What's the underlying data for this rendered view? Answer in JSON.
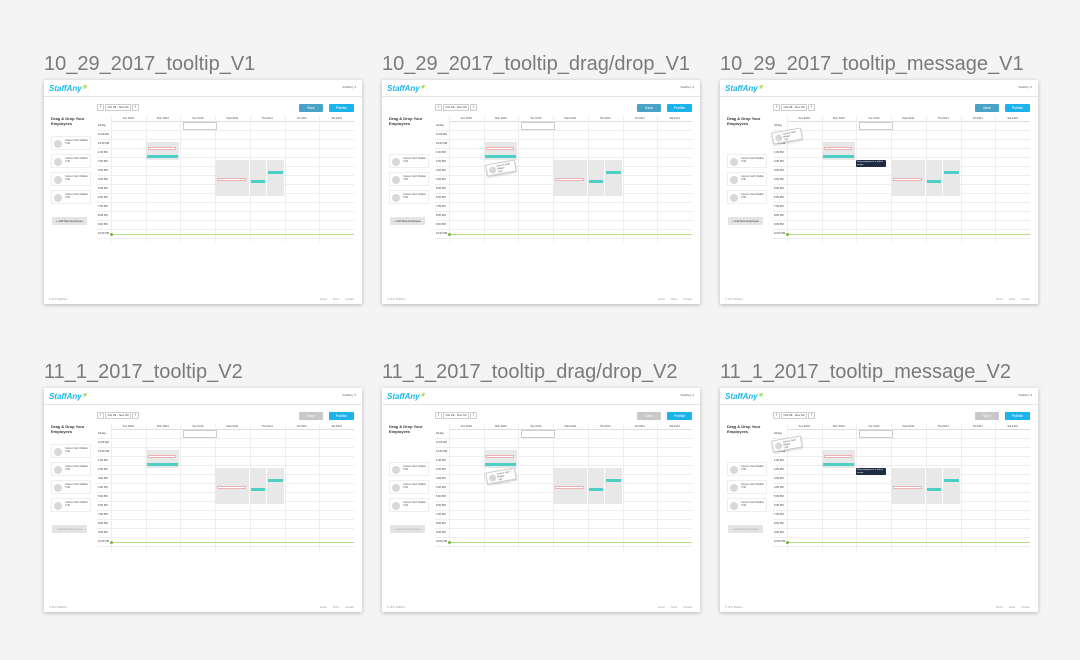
{
  "frames": [
    {
      "title": "10_29_2017_tooltip_V1",
      "variant": "v1",
      "state": "tooltip"
    },
    {
      "title": "10_29_2017_tooltip_drag/drop_V1",
      "variant": "v1",
      "state": "drag"
    },
    {
      "title": "10_29_2017_tooltip_message_V1",
      "variant": "v1",
      "state": "message"
    },
    {
      "title": "11_1_2017_tooltip_V2",
      "variant": "v2",
      "state": "tooltip"
    },
    {
      "title": "11_1_2017_tooltip_drag/drop_V2",
      "variant": "v2",
      "state": "drag"
    },
    {
      "title": "11_1_2017_tooltip_message_V2",
      "variant": "v2",
      "state": "message"
    }
  ],
  "app": {
    "logo": "StaffAny",
    "user_menu": "StaffAny ▾",
    "date_range": "Oct 29 - Nov 04",
    "save_label": "Save",
    "publish_label": "Publish",
    "sidebar_title": "Drag & Drop Your Employees",
    "add_employee_label": "+ Add New Employee",
    "employee_name": "Carson Seth Walker",
    "employee_hours": "7/40",
    "days": [
      "Sun 29/10",
      "Mon 30/10",
      "Tue 31/10",
      "Wed 01/11",
      "Thu 02/11",
      "Fri 03/11",
      "Sat 04/11"
    ],
    "times": [
      "All day",
      "11:00 AM",
      "12:00 PM",
      "1:00 PM",
      "2:00 PM",
      "3:00 PM",
      "4:00 PM",
      "5:00 PM",
      "6:00 PM",
      "7:00 PM",
      "8:00 PM",
      "9:00 PM",
      "10:00 PM"
    ],
    "footer_left": "© 2017 StaffAny",
    "footer_links": [
      "About",
      "Terms",
      "Contact"
    ],
    "tooltip_message": "Drag employee to a shift to assign"
  },
  "colors": {
    "accent": "#1ab4ea",
    "save": "#48a3c6",
    "teal_shift": "#4ecfc6",
    "grey_shift": "#e8e8e8"
  }
}
